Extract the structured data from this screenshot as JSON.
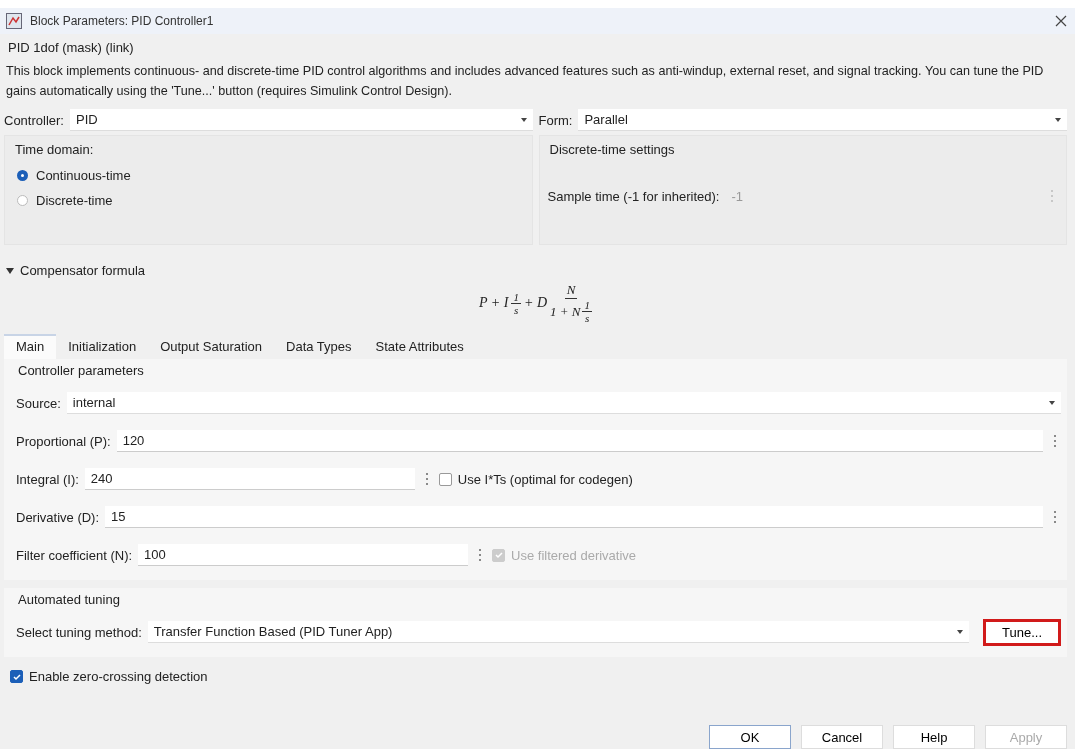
{
  "window": {
    "title": "Block Parameters: PID Controller1"
  },
  "mask_title": "PID 1dof (mask) (link)",
  "description": "This block implements continuous- and discrete-time PID control algorithms and includes advanced features such as anti-windup, external reset, and signal tracking. You can tune the PID gains automatically using the 'Tune...' button (requires Simulink Control Design).",
  "controller": {
    "label": "Controller:",
    "value": "PID"
  },
  "form": {
    "label": "Form:",
    "value": "Parallel"
  },
  "time_domain": {
    "title": "Time domain:",
    "options": [
      {
        "label": "Continuous-time",
        "selected": true
      },
      {
        "label": "Discrete-time",
        "selected": false
      }
    ]
  },
  "discrete_settings": {
    "title": "Discrete-time settings",
    "label": "Sample time (-1 for inherited):",
    "value": "-1",
    "disabled": true
  },
  "compensator": {
    "label": "Compensator formula",
    "expanded": true,
    "formula": {
      "lead": "P + I",
      "f1_num": "1",
      "f1_den": "s",
      "mid": "+ D",
      "f2_num": "N",
      "f2_den": "1 + N",
      "f3_num": "1",
      "f3_den": "s"
    }
  },
  "tabs": [
    {
      "label": "Main",
      "selected": true
    },
    {
      "label": "Initialization",
      "selected": false
    },
    {
      "label": "Output Saturation",
      "selected": false
    },
    {
      "label": "Data Types",
      "selected": false
    },
    {
      "label": "State Attributes",
      "selected": false
    }
  ],
  "controller_parameters": {
    "title": "Controller parameters",
    "rows": [
      {
        "kind": "dropdown",
        "label": "Source:",
        "value": "internal"
      },
      {
        "kind": "text",
        "label": "Proportional (P):",
        "value": "120"
      },
      {
        "kind": "text",
        "label": "Integral (I):",
        "value": "240",
        "option": {
          "label": "Use I*Ts (optimal for codegen)",
          "checked": false,
          "disabled": false
        }
      },
      {
        "kind": "text",
        "label": "Derivative (D):",
        "value": "15"
      },
      {
        "kind": "text",
        "label": "Filter coefficient (N):",
        "value": "100",
        "option": {
          "label": "Use filtered derivative",
          "checked": true,
          "disabled": true
        }
      }
    ]
  },
  "automated_tuning": {
    "title": "Automated tuning",
    "label": "Select tuning method:",
    "value": "Transfer Function Based (PID Tuner App)",
    "button": {
      "label": "Tune...",
      "highlighted": true
    }
  },
  "zero_crossing": {
    "label": "Enable zero-crossing detection",
    "checked": true
  },
  "buttons": [
    {
      "label": "OK",
      "disabled": false,
      "default": true
    },
    {
      "label": "Cancel",
      "disabled": false,
      "default": false
    },
    {
      "label": "Help",
      "disabled": false,
      "default": false
    },
    {
      "label": "Apply",
      "disabled": true,
      "default": false
    }
  ]
}
